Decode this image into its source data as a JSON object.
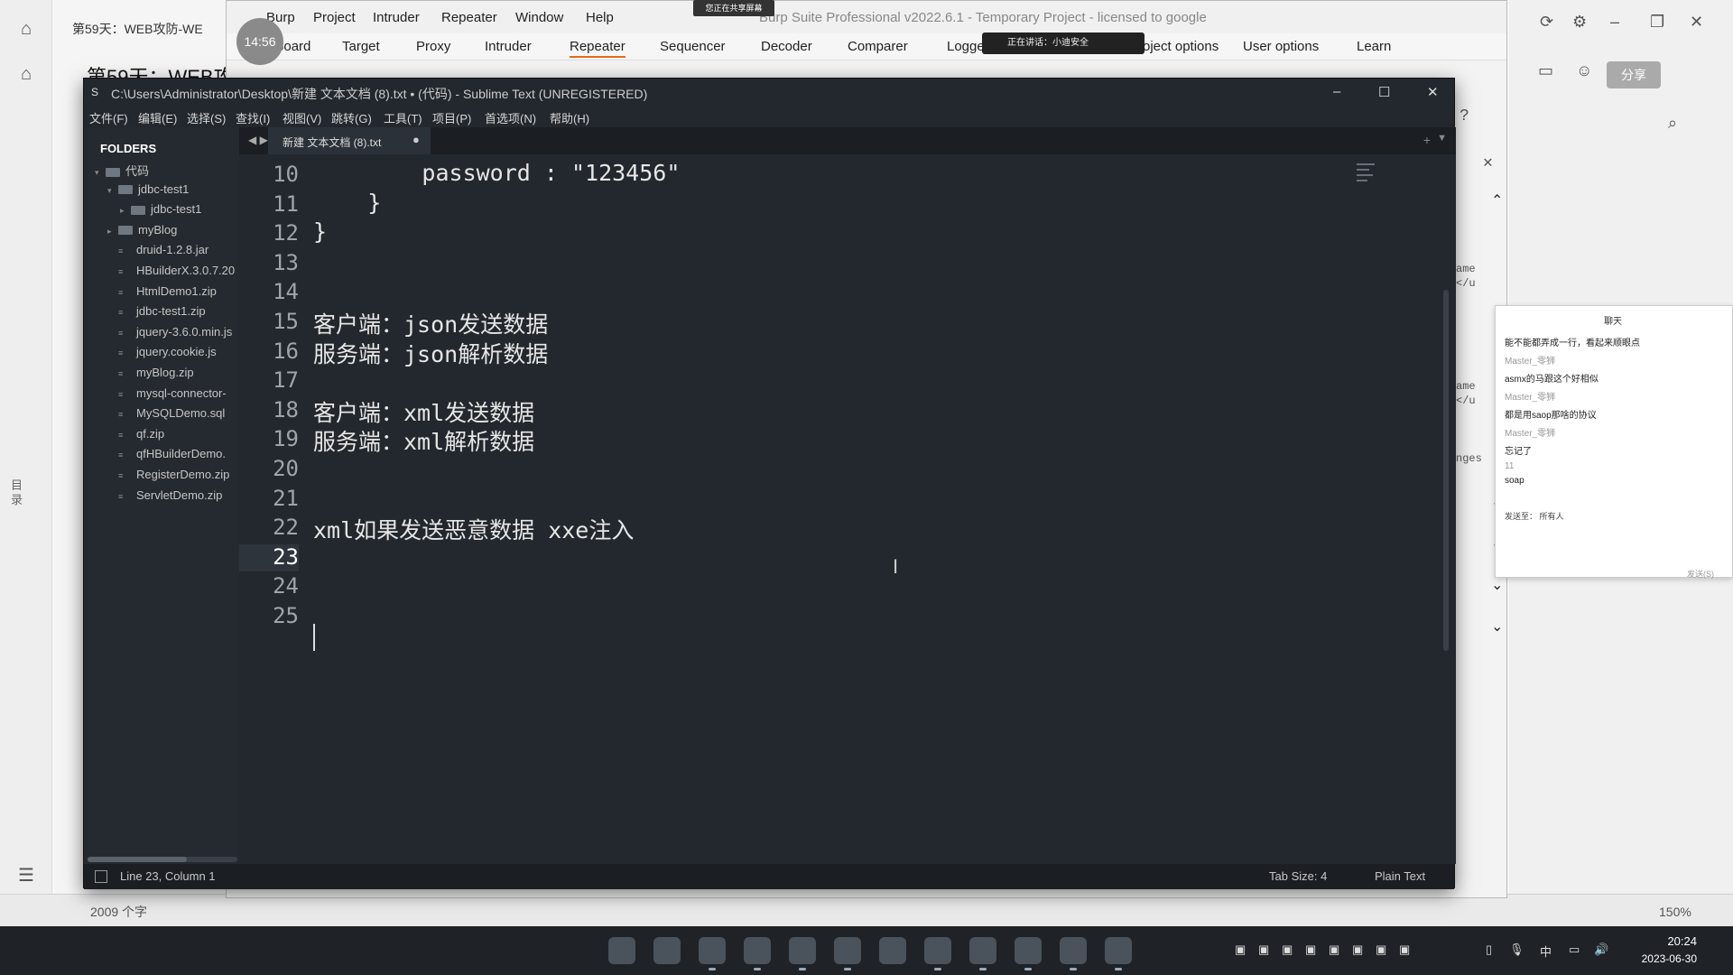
{
  "background_app": {
    "tab_title": "第59天：WEB攻防-WE",
    "heading": "第59天：WEB攻",
    "side_label": "目录",
    "share_button": "分享",
    "word_count": "2009 个字",
    "zoom": "150%"
  },
  "recording": {
    "timer": "14:56",
    "share_banner": "您正在共享屏幕",
    "notify": "正在讲话：小迪安全"
  },
  "burp": {
    "menu": [
      "Burp",
      "Project",
      "Intruder",
      "Repeater",
      "Window",
      "Help"
    ],
    "title": "Burp Suite Professional v2022.6.1 - Temporary Project - licensed to google",
    "tabs": [
      "Dashboard",
      "Target",
      "Proxy",
      "Intruder",
      "Repeater",
      "Sequencer",
      "Decoder",
      "Comparer",
      "Logger",
      "Project options",
      "User options",
      "Learn"
    ],
    "active_tab": "Repeater",
    "side_fragments": [
      "ame",
      "</u",
      "ame",
      "</u",
      "nges"
    ]
  },
  "chat": {
    "title": "聊天",
    "messages": [
      {
        "user": "",
        "text": "能不能都弄成一行，看起来顺眼点"
      },
      {
        "user": "Master_零狮",
        "text": "asmx的马跟这个好相似"
      },
      {
        "user": "Master_零狮",
        "text": "都是用saop那啥的协议"
      },
      {
        "user": "Master_零狮",
        "text": "忘记了"
      },
      {
        "user": "11",
        "text": "soap"
      }
    ],
    "send_to": "发送至：",
    "recipient": "所有人",
    "send_button": "发送(S)"
  },
  "sublime": {
    "title": "C:\\Users\\Administrator\\Desktop\\新建 文本文档 (8).txt • (代码) - Sublime Text (UNREGISTERED)",
    "menu": [
      "文件(F)",
      "编辑(E)",
      "选择(S)",
      "查找(I)",
      "视图(V)",
      "跳转(G)",
      "工具(T)",
      "项目(P)",
      "首选项(N)",
      "帮助(H)"
    ],
    "sidebar": {
      "header": "FOLDERS",
      "items": [
        {
          "label": "代码",
          "kind": "folder",
          "depth": 0,
          "arrow": "▾"
        },
        {
          "label": "jdbc-test1",
          "kind": "folder",
          "depth": 1,
          "arrow": "▾"
        },
        {
          "label": "jdbc-test1",
          "kind": "folder",
          "depth": 2,
          "arrow": "▸"
        },
        {
          "label": "myBlog",
          "kind": "folder",
          "depth": 1,
          "arrow": "▸"
        },
        {
          "label": "druid-1.2.8.jar",
          "kind": "file",
          "depth": 1,
          "arrow": ""
        },
        {
          "label": "HBuilderX.3.0.7.20",
          "kind": "file",
          "depth": 1,
          "arrow": ""
        },
        {
          "label": "HtmlDemo1.zip",
          "kind": "file",
          "depth": 1,
          "arrow": ""
        },
        {
          "label": "jdbc-test1.zip",
          "kind": "file",
          "depth": 1,
          "arrow": ""
        },
        {
          "label": "jquery-3.6.0.min.js",
          "kind": "file",
          "depth": 1,
          "arrow": ""
        },
        {
          "label": "jquery.cookie.js",
          "kind": "file",
          "depth": 1,
          "arrow": ""
        },
        {
          "label": "myBlog.zip",
          "kind": "file",
          "depth": 1,
          "arrow": ""
        },
        {
          "label": "mysql-connector-",
          "kind": "file",
          "depth": 1,
          "arrow": ""
        },
        {
          "label": "MySQLDemo.sql",
          "kind": "file",
          "depth": 1,
          "arrow": ""
        },
        {
          "label": "qf.zip",
          "kind": "file",
          "depth": 1,
          "arrow": ""
        },
        {
          "label": "qfHBuilderDemo.",
          "kind": "file",
          "depth": 1,
          "arrow": ""
        },
        {
          "label": "RegisterDemo.zip",
          "kind": "file",
          "depth": 1,
          "arrow": ""
        },
        {
          "label": "ServletDemo.zip",
          "kind": "file",
          "depth": 1,
          "arrow": ""
        }
      ]
    },
    "tab": {
      "label": "新建 文本文档 (8).txt",
      "dirty": "●"
    },
    "lines": [
      {
        "n": "10",
        "text": "        password : \"123456\""
      },
      {
        "n": "11",
        "text": "    }"
      },
      {
        "n": "12",
        "text": "}"
      },
      {
        "n": "13",
        "text": ""
      },
      {
        "n": "14",
        "text": ""
      },
      {
        "n": "15",
        "text": "客户端：json发送数据"
      },
      {
        "n": "16",
        "text": "服务端：json解析数据"
      },
      {
        "n": "17",
        "text": ""
      },
      {
        "n": "18",
        "text": "客户端：xml发送数据"
      },
      {
        "n": "19",
        "text": "服务端：xml解析数据"
      },
      {
        "n": "20",
        "text": ""
      },
      {
        "n": "21",
        "text": ""
      },
      {
        "n": "22",
        "text": "xml如果发送恶意数据 xxe注入"
      },
      {
        "n": "23",
        "text": ""
      },
      {
        "n": "24",
        "text": ""
      },
      {
        "n": "25",
        "text": ""
      }
    ],
    "active_line": "23",
    "status": {
      "position": "Line 23, Column 1",
      "tab_size": "Tab Size: 4",
      "syntax": "Plain Text"
    }
  },
  "taskbar": {
    "ime": "中",
    "time": "20:24",
    "date": "2023-06-30"
  }
}
